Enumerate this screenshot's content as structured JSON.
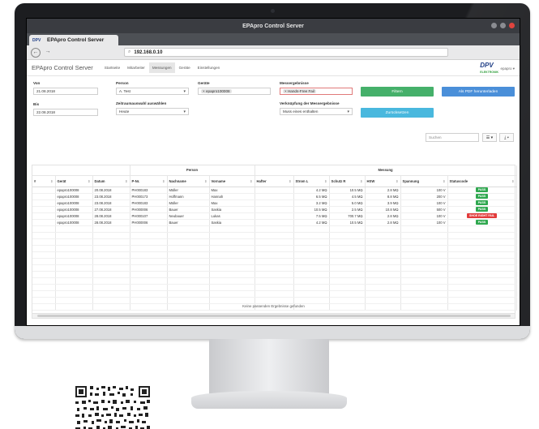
{
  "window": {
    "title": "EPApro Control Server"
  },
  "browser": {
    "tab_title": "EPApro Control Server",
    "tab_logo": "DPV",
    "back": "←",
    "forward": "→",
    "url": "192.168.0.10"
  },
  "nav": {
    "brand": "EPApro Control Server",
    "items": [
      "Startseite",
      "Mitarbeiter",
      "Messungen",
      "Geräte",
      "Einstellungen"
    ],
    "logo": "DPV",
    "logo_sub": "ELEKTRONIK",
    "user": "epapro ▾"
  },
  "filters": {
    "von_label": "Von",
    "von_value": "21.08.2018",
    "bis_label": "Bis",
    "bis_value": "22.08.2018",
    "person_label": "Person",
    "person_value": "A. Test",
    "zeitraum_label": "Zeitraumauswahl auswählen",
    "zeitraum_value": "Heute",
    "geraete_label": "Geräte",
    "geraete_chip": "× epapro100008",
    "messergebnisse_label": "Messergebnisse",
    "messergebnisse_chip": "× Hands-Free Fail",
    "verknuepfung_label": "Verknüpfung der Messergebnisse",
    "verknuepfung_value": "Muss eines enthalten",
    "filtern_btn": "Filtern",
    "pdf_btn": "Als PDF herunterladen",
    "zuruecksetzen_btn": "Zurücksetzen",
    "search_placeholder": "Suchen",
    "columns_btn": "☰ ▾",
    "export_btn": "⤓ ▾"
  },
  "table": {
    "groups": {
      "person": "Person",
      "messung": "Messung"
    },
    "columns": [
      "#",
      "Gerät",
      "Datum",
      "P-Nr.",
      "Nachname",
      "Vorname",
      "Hafter",
      "Strom L",
      "Schutz R",
      "HSW",
      "Spannung",
      "Statuscode"
    ],
    "rows": [
      {
        "nr": "",
        "geraet": "epapro100008",
        "datum": "20.08.2018",
        "pnr": "PH000183",
        "nachname": "Müller",
        "vorname": "Max",
        "hafter": "",
        "strom": "4.2 MΩ",
        "schutz": "10.5 MΩ",
        "hsw": "2.8 MΩ",
        "spannung": "100 V",
        "status": "PASS",
        "status_color": "#2fa84f"
      },
      {
        "nr": "",
        "geraet": "epapro100008",
        "datum": "23.08.2018",
        "pnr": "PH000173",
        "nachname": "Hoffmann",
        "vorname": "Hannah",
        "hafter": "",
        "strom": "6.5 MΩ",
        "schutz": "4.5 MΩ",
        "hsw": "8.8 MΩ",
        "spannung": "200 V",
        "status": "PASS",
        "status_color": "#2fa84f"
      },
      {
        "nr": "",
        "geraet": "epapro100008",
        "datum": "23.08.2018",
        "pnr": "PH000183",
        "nachname": "Müller",
        "vorname": "Max",
        "hafter": "",
        "strom": "3.2 MΩ",
        "schutz": "5.0 MΩ",
        "hsw": "3.9 MΩ",
        "spannung": "100 V",
        "status": "PASS",
        "status_color": "#2fa84f"
      },
      {
        "nr": "",
        "geraet": "epapro100008",
        "datum": "27.08.2018",
        "pnr": "PH000006",
        "nachname": "Bauer",
        "vorname": "Saskia",
        "hafter": "",
        "strom": "10.5 MΩ",
        "schutz": "2.5 MΩ",
        "hsw": "10.8 MΩ",
        "spannung": "500 V",
        "status": "PASS",
        "status_color": "#2fa84f"
      },
      {
        "nr": "",
        "geraet": "epapro100008",
        "datum": "28.08.2018",
        "pnr": "PH000107",
        "nachname": "Neubauer",
        "vorname": "Lukas",
        "hafter": "",
        "strom": "7.5 MΩ",
        "schutz": "700.7 MΩ",
        "hsw": "2.8 MΩ",
        "spannung": "100 V",
        "status": "SHOE RIGHT FAIL",
        "status_color": "#e23b3b"
      },
      {
        "nr": "",
        "geraet": "epapro100008",
        "datum": "28.08.2018",
        "pnr": "PH000006",
        "nachname": "Bauer",
        "vorname": "Saskia",
        "hafter": "",
        "strom": "4.2 MΩ",
        "schutz": "10.5 MΩ",
        "hsw": "2.8 MΩ",
        "spannung": "100 V",
        "status": "PASS",
        "status_color": "#2fa84f"
      }
    ],
    "empty_text": "Keine passenden Ergebnisse gefunden"
  },
  "colors": {
    "green_btn": "#45b06a",
    "blue_btn": "#4a8fd9",
    "teal_btn": "#49b8de",
    "fail": "#e23b3b",
    "pass": "#2fa84f"
  }
}
